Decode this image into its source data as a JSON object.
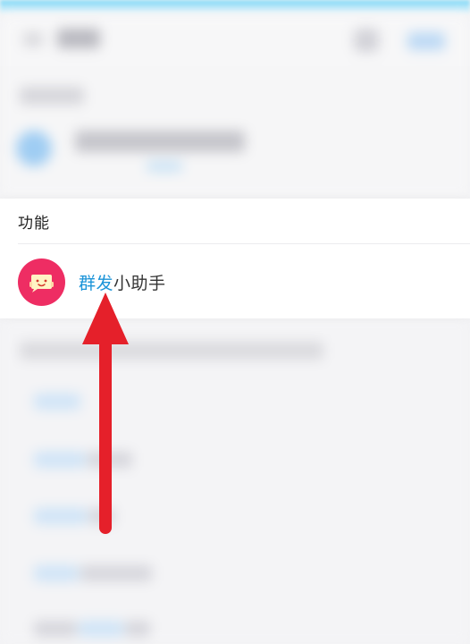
{
  "function_section": {
    "title": "功能",
    "item": {
      "label_highlight": "群发",
      "label_rest": "小助手",
      "icon": "bulk-message-assistant-icon",
      "avatar_color": "#ee2d63"
    }
  },
  "annotation": {
    "color": "#e5202a"
  }
}
